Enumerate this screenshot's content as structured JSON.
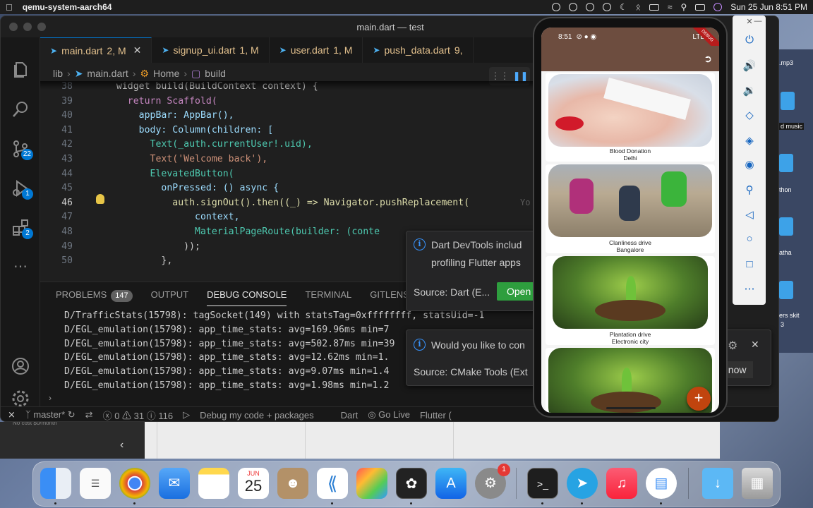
{
  "menubar": {
    "app_name": "qemu-system-aarch64",
    "datetime": "Sun 25 Jun  8:51 PM"
  },
  "background_windows": {
    "labels": [
      ".mp3",
      "d music",
      "thon",
      "atha",
      "ers skit",
      "3"
    ],
    "small_text": "No cost $0/month"
  },
  "vscode": {
    "window_title": "main.dart — test",
    "activity_badges": {
      "source_control": "22",
      "run_debug": "1",
      "extensions": "2"
    },
    "tabs": [
      {
        "name": "main.dart",
        "status": "2, M"
      },
      {
        "name": "signup_ui.dart",
        "status": "1, M"
      },
      {
        "name": "user.dart",
        "status": "1, M"
      },
      {
        "name": "push_data.dart",
        "status": "9,"
      }
    ],
    "breadcrumb": [
      "lib",
      "main.dart",
      "Home",
      "build"
    ],
    "code_lines": [
      {
        "n": "38",
        "text": "  widget build(BuildContext context) {"
      },
      {
        "n": "39",
        "text": "    return Scaffold("
      },
      {
        "n": "40",
        "text": "      appBar: AppBar(),"
      },
      {
        "n": "41",
        "text": "      body: Column(children: ["
      },
      {
        "n": "42",
        "text": "        Text(_auth.currentUser!.uid),"
      },
      {
        "n": "43",
        "text": "        Text('Welcome back'),"
      },
      {
        "n": "44",
        "text": "        ElevatedButton("
      },
      {
        "n": "45",
        "text": "          onPressed: () async {"
      },
      {
        "n": "46",
        "text": "            auth.signOut().then((_) => Navigator.pushReplacement("
      },
      {
        "n": "47",
        "text": "                context,"
      },
      {
        "n": "48",
        "text": "                MaterialPageRoute(builder: (conte"
      },
      {
        "n": "49",
        "text": "              ));"
      },
      {
        "n": "50",
        "text": "          },"
      }
    ],
    "inline_hint": "Yo",
    "panel_tabs": {
      "problems": "PROBLEMS",
      "problems_count": "147",
      "output": "OUTPUT",
      "debug_console": "DEBUG CONSOLE",
      "terminal": "TERMINAL",
      "gitlens": "GITLENS"
    },
    "console_lines": [
      "D/TrafficStats(15798): tagSocket(149) with statsTag=0xffffffff, statsUid=-1",
      "D/EGL_emulation(15798): app_time_stats: avg=169.96ms min=7",
      "D/EGL_emulation(15798): app_time_stats: avg=502.87ms min=39",
      "D/EGL_emulation(15798): app_time_stats: avg=12.62ms min=1.",
      "D/EGL_emulation(15798): app_time_stats: avg=9.07ms min=1.4",
      "D/EGL_emulation(15798): app_time_stats: avg=1.98ms min=1.2"
    ],
    "status_bar": {
      "branch": "master*",
      "errors": "0",
      "warnings": "31",
      "info": "116",
      "debug_label": "Debug my code + packages",
      "language": "Dart",
      "go_live": "Go Live",
      "flutter": "Flutter ("
    },
    "notifications": [
      {
        "message_line1": "Dart DevTools includ",
        "message_line2": "profiling Flutter apps",
        "source": "Source: Dart (E...",
        "button": "Open"
      },
      {
        "message_line1": "Would you like to con",
        "source": "Source: CMake Tools (Ext",
        "button": "t now"
      }
    ]
  },
  "emulator": {
    "time": "8:51",
    "network": "LTE",
    "debug_banner": "DEBUG",
    "cards": [
      {
        "title": "Blood Donation",
        "location": "Delhi"
      },
      {
        "title": "Clanliness drive",
        "location": "Bangalore"
      },
      {
        "title": "Plantation drive",
        "location": "Electronic city"
      },
      {
        "title": "",
        "location": ""
      }
    ],
    "fab": "+"
  },
  "dock": {
    "calendar_month": "JUN",
    "calendar_day": "25",
    "settings_badge": "1"
  }
}
